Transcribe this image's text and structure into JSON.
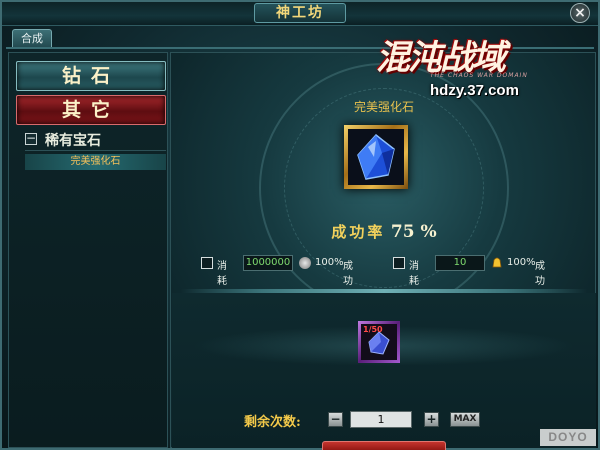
{
  "window": {
    "title": "神工坊",
    "close_glyph": "×"
  },
  "tabs": [
    {
      "label": "合成"
    }
  ],
  "sidebar": {
    "categories": [
      {
        "label": "钻石"
      },
      {
        "label": "其它"
      }
    ],
    "subcategory": {
      "label": "稀有宝石",
      "toggle": "−"
    },
    "items": [
      {
        "label": "完美强化石"
      }
    ]
  },
  "crafting": {
    "target_name": "完美强化石",
    "success_label": "成功率",
    "success_value": "75 %",
    "costs": [
      {
        "label": "消耗",
        "value": "1000000",
        "percent": "100%",
        "success_text": "成功",
        "currency_icon": "silver-coin-icon"
      },
      {
        "label": "消耗",
        "value": "10",
        "percent": "100%",
        "success_text": "成功",
        "currency_icon": "gold-ingot-icon"
      }
    ],
    "material": {
      "count": "1/50"
    },
    "remaining": {
      "label": "剩余次数:",
      "minus": "−",
      "value": "1",
      "plus": "+",
      "max": "MAX"
    }
  },
  "logo": {
    "title": "混沌战域",
    "subtitle": "THE CHAOS WAR DOMAIN",
    "url": "hdzy.37.com"
  },
  "watermark": "DOYO",
  "colors": {
    "accent_gold": "#f2d15c",
    "selected_red": "#a8282c",
    "teal_panel": "#1e4a52"
  }
}
